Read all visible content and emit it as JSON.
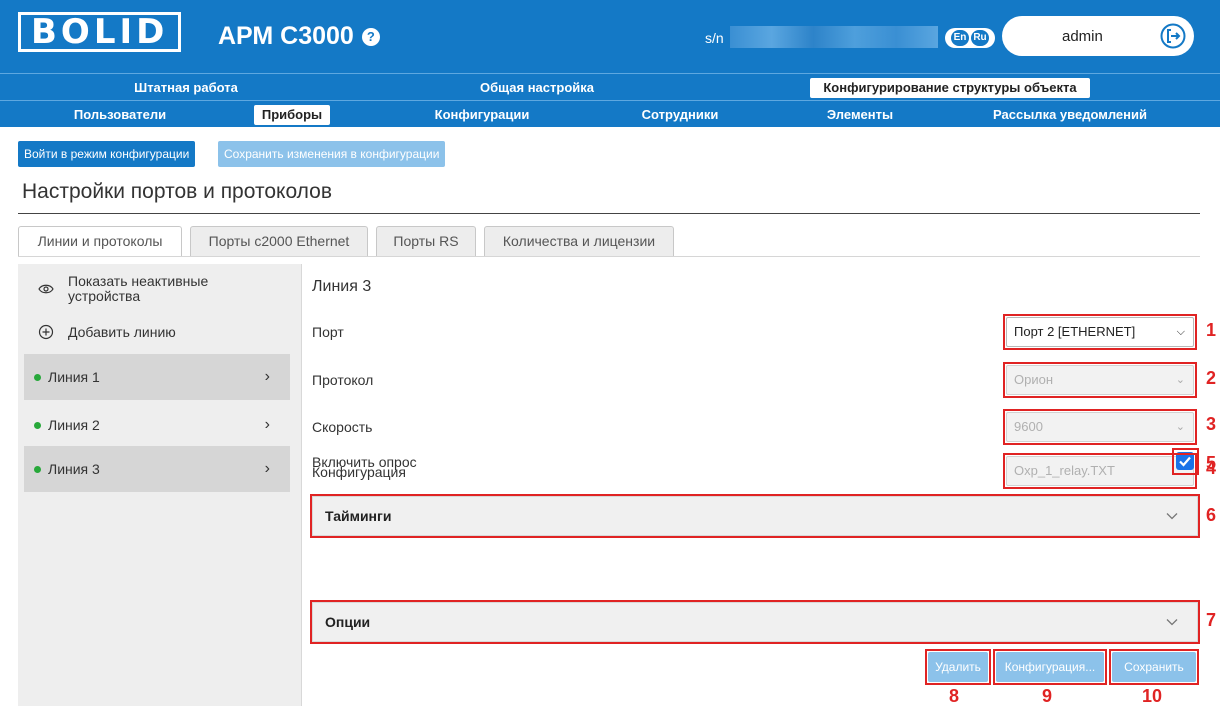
{
  "header": {
    "logo_text": "BOLID",
    "app_title": "АРМ С3000",
    "help_icon": "?",
    "sn_label": "s/n",
    "lang_en": "En",
    "lang_ru": "Ru",
    "user": "admin"
  },
  "nav_top": [
    {
      "label": "Штатная работа"
    },
    {
      "label": "Общая настройка"
    },
    {
      "label": "Конфигурирование структуры объекта",
      "active": true
    }
  ],
  "nav_sub": [
    {
      "label": "Пользователи"
    },
    {
      "label": "Приборы",
      "active": true
    },
    {
      "label": "Конфигурации"
    },
    {
      "label": "Сотрудники"
    },
    {
      "label": "Элементы"
    },
    {
      "label": "Рассылка уведомлений"
    }
  ],
  "actions": {
    "enter_config": "Войти в режим конфигурации",
    "save_config": "Сохранить изменения в конфигурации"
  },
  "page_title": "Настройки портов и протоколов",
  "tabs": [
    {
      "label": "Линии и протоколы",
      "active": true
    },
    {
      "label": "Порты c2000 Ethernet"
    },
    {
      "label": "Порты RS"
    },
    {
      "label": "Количества и лицензии"
    }
  ],
  "left_panel": {
    "show_inactive": "Показать неактивные устройства",
    "add_line": "Добавить линию",
    "lines": [
      {
        "label": "Линия 1",
        "status": "active"
      },
      {
        "label": "Линия 2",
        "status": "active"
      },
      {
        "label": "Линия 3",
        "status": "active"
      }
    ]
  },
  "form": {
    "title": "Линия 3",
    "port_label": "Порт",
    "port_value": "Порт 2 [ETHERNET]",
    "protocol_label": "Протокол",
    "protocol_value": "Орион",
    "speed_label": "Скорость",
    "speed_value": "9600",
    "config_label": "Конфигурация",
    "config_value": "Oxp_1_relay.TXT",
    "poll_label": "Включить опрос",
    "poll_enabled": true,
    "timings": "Тайминги",
    "options": "Опции",
    "delete": "Удалить",
    "configuration": "Конфигурация...",
    "save": "Сохранить"
  },
  "annotations": [
    "1",
    "2",
    "3",
    "4",
    "5",
    "6",
    "7",
    "8",
    "9",
    "10"
  ],
  "colors": {
    "brand_blue": "#1479c6",
    "disabled_blue": "#8cc2ea",
    "annotation_red": "#e02323",
    "status_green": "#27a83a"
  }
}
